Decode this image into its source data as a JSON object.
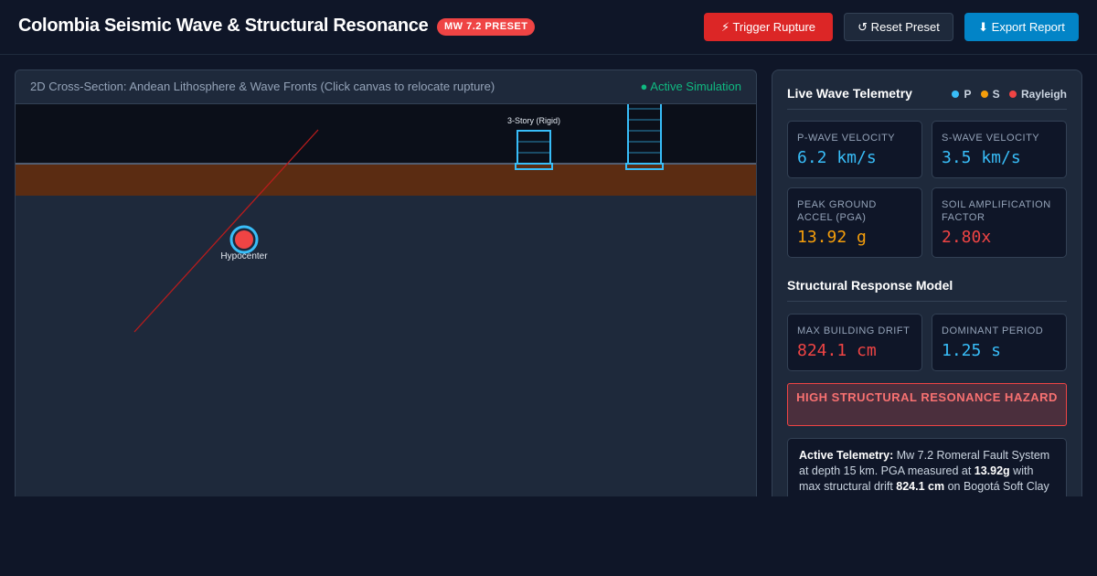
{
  "header": {
    "title": "Colombia Seismic Wave & Structural Resonance",
    "preset_badge": "MW 7.2 PRESET",
    "buttons": {
      "trigger": "⚡ Trigger Rupture",
      "reset": "↺ Reset Preset",
      "export": "⬇ Export Report"
    }
  },
  "simulation": {
    "title": "2D Cross-Section: Andean Lithosphere & Wave Fronts (Click canvas to relocate rupture)",
    "status": "● Active Simulation",
    "canvas": {
      "hypocenter_label": "Hypocenter",
      "building_label": "3-Story (Rigid)",
      "colors": {
        "sky": "#0b0f19",
        "soil": "#5b2c12",
        "crust": "#1e293b",
        "fault": "#b91c1c",
        "building": "#38bdf8",
        "hypocenter": "#ef4444"
      }
    }
  },
  "telemetry": {
    "title": "Live Wave Telemetry",
    "legend": [
      {
        "label": "P",
        "color": "#38bdf8"
      },
      {
        "label": "S",
        "color": "#f59e0b"
      },
      {
        "label": "Rayleigh",
        "color": "#ef4444"
      }
    ],
    "cards": [
      {
        "label": "P-Wave Velocity",
        "value": "6.2 km/s",
        "color": "#38bdf8"
      },
      {
        "label": "S-Wave Velocity",
        "value": "3.5 km/s",
        "color": "#38bdf8"
      },
      {
        "label": "Peak Ground Accel (PGA)",
        "value": "13.92 g",
        "color": "#f59e0b"
      },
      {
        "label": "Soil Amplification Factor",
        "value": "2.80x",
        "color": "#ef4444"
      }
    ]
  },
  "structural": {
    "title": "Structural Response Model",
    "cards": [
      {
        "label": "Max Building Drift",
        "value": "824.1 cm",
        "color": "#ef4444"
      },
      {
        "label": "Dominant Period",
        "value": "1.25 s",
        "color": "#38bdf8"
      }
    ],
    "alert": "HIGH STRUCTURAL RESONANCE HAZARD",
    "summary": {
      "heading": "Active Telemetry:",
      "text1": " Mw 7.2 Romeral Fault System at depth 15 km. PGA measured at ",
      "pga": "13.92g",
      "text2": " with max structural drift ",
      "drift": "824.1 cm",
      "text3": " on Bogotá Soft Clay"
    }
  }
}
